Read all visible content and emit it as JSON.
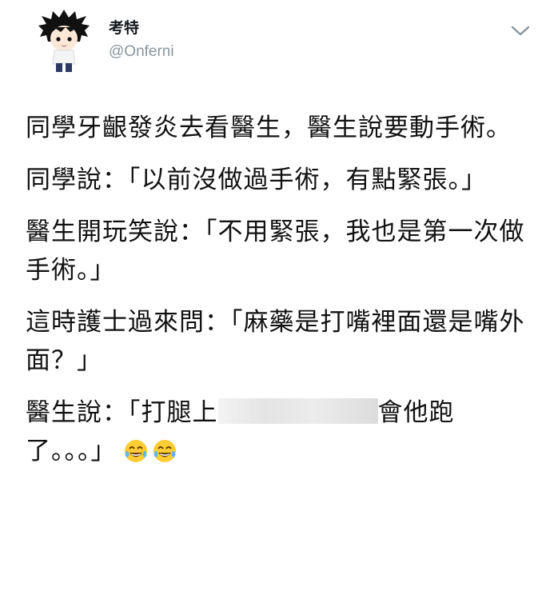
{
  "user": {
    "display_name": "考特",
    "handle": "@Onferni"
  },
  "icons": {
    "menu": "chevron-down-icon",
    "emoji": "face-with-tears-of-joy-icon"
  },
  "tweet": {
    "para1": "同學牙齦發炎去看醫生，醫生說要動手術。",
    "para2": "同學說：「以前沒做過手術，有點緊張。」",
    "para3": "醫生開玩笑說：「不用緊張，我也是第一次做手術。」",
    "para4": "這時護士過來問：「麻藥是打嘴裡面還是嘴外面？」",
    "para5_before": "醫生說：「打腿上",
    "para5_after": "會他跑了。。。」"
  },
  "colors": {
    "handle": "#8a959e",
    "text": "#111111",
    "emoji_yellow": "#ffcc33",
    "tears": "#5db8f0"
  }
}
